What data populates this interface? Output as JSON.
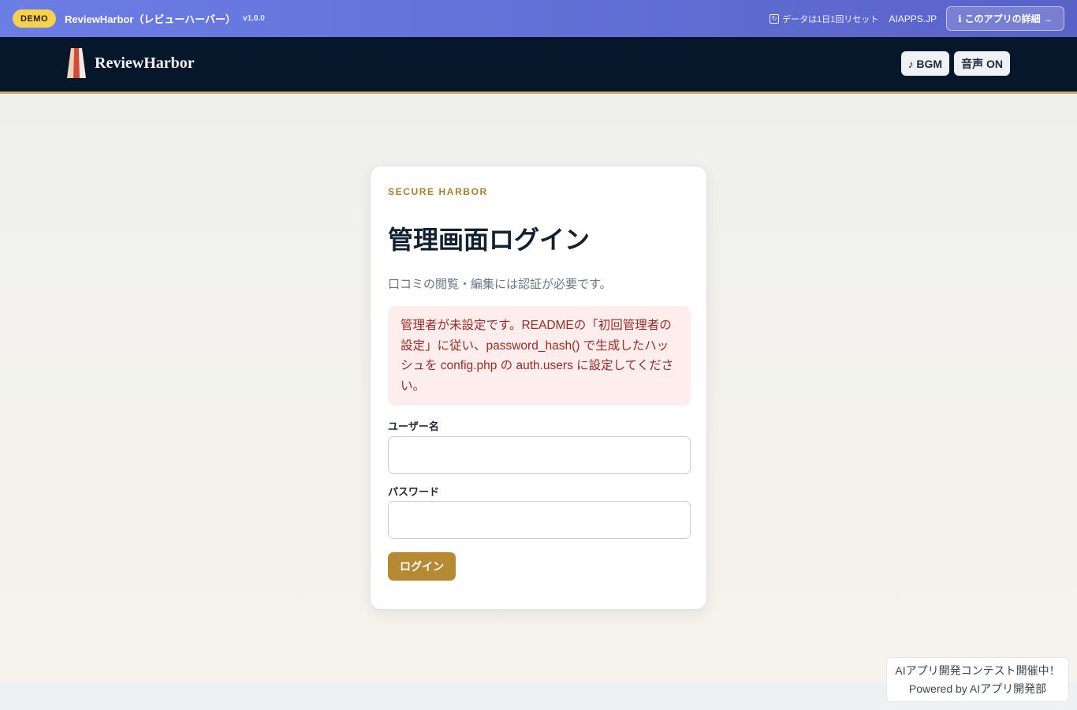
{
  "demo_bar": {
    "badge": "DEMO",
    "title": "ReviewHarbor（レビューハーバー）",
    "version": "v1.0.0",
    "reset_note": "データは1日1回リセット",
    "site": "AIAPPS.JP",
    "detail_button": "このアプリの詳細 →"
  },
  "header": {
    "logo_text": "ReviewHarbor",
    "bgm_button": "♪ BGM",
    "sound_button": "音声 ON"
  },
  "login": {
    "eyebrow": "SECURE HARBOR",
    "title": "管理画面ログイン",
    "subtitle": "口コミの閲覧・編集には認証が必要です。",
    "alert": "管理者が未設定です。READMEの「初回管理者の設定」に従い、password_hash() で生成したハッシュを config.php の auth.users に設定してください。",
    "username_label": "ユーザー名",
    "username_value": "",
    "password_label": "パスワード",
    "password_value": "",
    "submit_label": "ログイン"
  },
  "contest": {
    "line1": "AIアプリ開発コンテスト開催中！",
    "line2": "Powered by AIアプリ開発部"
  },
  "colors": {
    "demo_gradient_start": "#6b7ee6",
    "demo_gradient_end": "#5a62c8",
    "header_bg": "#07172b",
    "accent_gold": "#b68a33",
    "alert_bg": "#fdeeed",
    "alert_text": "#9a2b26"
  },
  "icons": {
    "reset": "refresh-icon",
    "info": "info-icon",
    "logo": "lighthouse-logo-icon"
  }
}
